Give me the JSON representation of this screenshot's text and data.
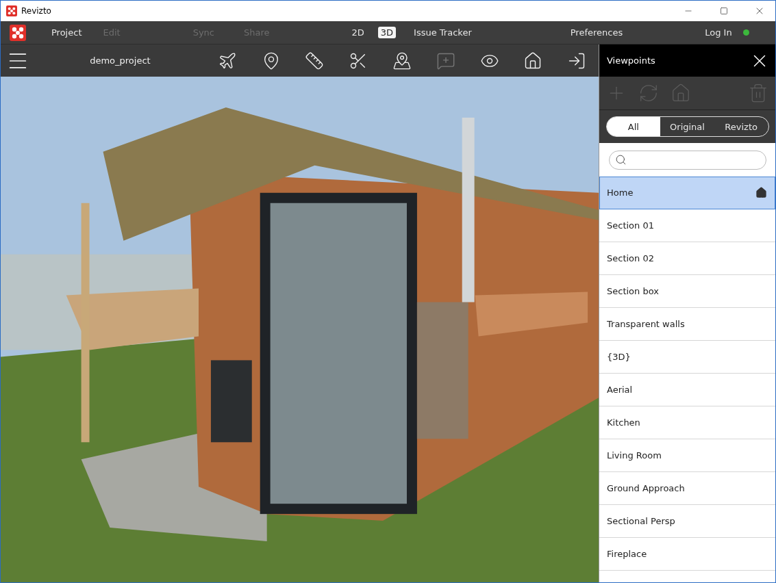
{
  "window": {
    "title": "Revizto"
  },
  "menu": [
    {
      "label": "Project",
      "disabled": false
    },
    {
      "label": "Edit",
      "disabled": true
    },
    {
      "label": "Sync",
      "disabled": true
    },
    {
      "label": "Share",
      "disabled": true
    }
  ],
  "view_modes": [
    {
      "label": "2D",
      "selected": false
    },
    {
      "label": "3D",
      "selected": true
    }
  ],
  "issue_tracker": "Issue Tracker",
  "preferences": "Preferences",
  "login": {
    "label": "Log In",
    "online": true
  },
  "project_name": "demo_project",
  "tools": [
    {
      "disabled": false
    },
    {
      "disabled": false
    },
    {
      "disabled": false
    },
    {
      "disabled": false
    },
    {
      "disabled": false
    },
    {
      "disabled": true
    },
    {
      "disabled": false
    },
    {
      "disabled": false
    },
    {
      "disabled": false
    }
  ],
  "viewpoints": {
    "title": "Viewpoints",
    "actions": [
      {
        "disabled": true
      },
      {
        "disabled": true
      },
      {
        "disabled": true
      },
      {
        "disabled": true
      }
    ],
    "filters": [
      {
        "label": "All",
        "selected": true
      },
      {
        "label": "Original",
        "selected": false
      },
      {
        "label": "Revizto",
        "selected": false
      }
    ],
    "items": [
      {
        "name": "Home",
        "selected": true,
        "home": true
      },
      {
        "name": "Section 01",
        "selected": false,
        "home": false
      },
      {
        "name": "Section 02",
        "selected": false,
        "home": false
      },
      {
        "name": "Section box",
        "selected": false,
        "home": false
      },
      {
        "name": "Transparent walls",
        "selected": false,
        "home": false
      },
      {
        "name": "{3D}",
        "selected": false,
        "home": false
      },
      {
        "name": "Aerial",
        "selected": false,
        "home": false
      },
      {
        "name": "Kitchen",
        "selected": false,
        "home": false
      },
      {
        "name": "Living Room",
        "selected": false,
        "home": false
      },
      {
        "name": "Ground Approach",
        "selected": false,
        "home": false
      },
      {
        "name": "Sectional Persp",
        "selected": false,
        "home": false
      },
      {
        "name": "Fireplace",
        "selected": false,
        "home": false
      }
    ]
  }
}
